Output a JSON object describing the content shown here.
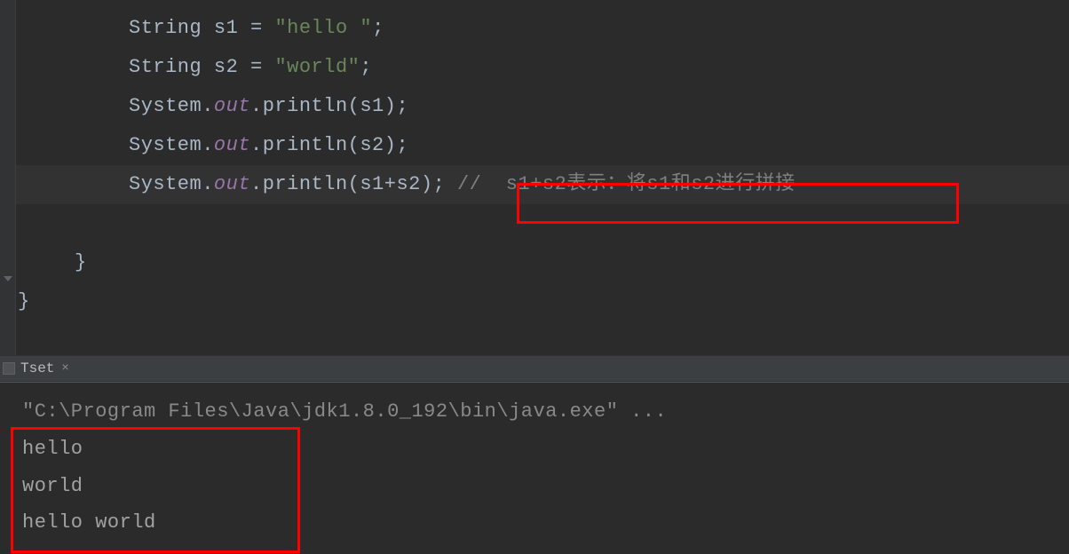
{
  "editor": {
    "lines": [
      {
        "type": "code",
        "indent": 3,
        "tokens": [
          {
            "text": "String s1 = ",
            "class": "normal"
          },
          {
            "text": "\"hello \"",
            "class": "string"
          },
          {
            "text": ";",
            "class": "normal"
          }
        ]
      },
      {
        "type": "code",
        "indent": 3,
        "tokens": [
          {
            "text": "String s2 = ",
            "class": "normal"
          },
          {
            "text": "\"world\"",
            "class": "string"
          },
          {
            "text": ";",
            "class": "normal"
          }
        ]
      },
      {
        "type": "code",
        "indent": 3,
        "tokens": [
          {
            "text": "System.",
            "class": "normal"
          },
          {
            "text": "out",
            "class": "field-italic"
          },
          {
            "text": ".println(s1);",
            "class": "normal"
          }
        ]
      },
      {
        "type": "code",
        "indent": 3,
        "tokens": [
          {
            "text": "System.",
            "class": "normal"
          },
          {
            "text": "out",
            "class": "field-italic"
          },
          {
            "text": ".println(s2);",
            "class": "normal"
          }
        ]
      },
      {
        "type": "code",
        "indent": 3,
        "highlighted": true,
        "tokens": [
          {
            "text": "System.",
            "class": "normal"
          },
          {
            "text": "out",
            "class": "field-italic"
          },
          {
            "text": ".println(s1+s2); ",
            "class": "normal"
          },
          {
            "text": "//  s1+s2表示：将s1和s2进行拼接",
            "class": "comment"
          }
        ]
      },
      {
        "type": "empty"
      },
      {
        "type": "code",
        "indent": 2,
        "tokens": [
          {
            "text": "}",
            "class": "normal"
          }
        ]
      },
      {
        "type": "code",
        "indent": 0,
        "tokens": [
          {
            "text": "}",
            "class": "normal"
          }
        ]
      }
    ]
  },
  "tab": {
    "name": "Tset",
    "close_symbol": "×"
  },
  "console": {
    "path_line": "\"C:\\Program Files\\Java\\jdk1.8.0_192\\bin\\java.exe\" ...",
    "output_lines": [
      "hello ",
      "world",
      "hello world"
    ]
  }
}
